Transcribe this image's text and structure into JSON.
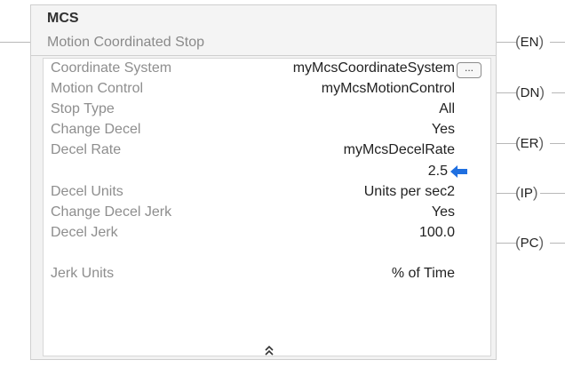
{
  "instruction": {
    "mnemonic": "MCS",
    "description": "Motion Coordinated Stop"
  },
  "parameters": [
    {
      "label": "Coordinate System",
      "value": "myMcsCoordinateSystem"
    },
    {
      "label": "Motion Control",
      "value": "myMcsMotionControl"
    },
    {
      "label": "Stop Type",
      "value": "All"
    },
    {
      "label": "Change Decel",
      "value": "Yes"
    },
    {
      "label": "Decel Rate",
      "value": "myMcsDecelRate"
    },
    {
      "label": "",
      "value": "2.5"
    },
    {
      "label": "Decel Units",
      "value": "Units per sec2"
    },
    {
      "label": "Change Decel Jerk",
      "value": "Yes"
    },
    {
      "label": "Decel Jerk",
      "value": "100.0"
    },
    {
      "label": "Jerk Units",
      "value": "% of Time"
    }
  ],
  "browse_button": {
    "label": "..."
  },
  "outputs": [
    "EN",
    "DN",
    "ER",
    "IP",
    "PC"
  ],
  "icons": {
    "browse": "ellipsis-browse-icon",
    "value_arrow": "left-arrow-icon",
    "collapse": "double-chevron-up-icon"
  },
  "colors": {
    "arrow": "#1f6fe0",
    "label": "#8e8e8e",
    "value": "#222222"
  }
}
